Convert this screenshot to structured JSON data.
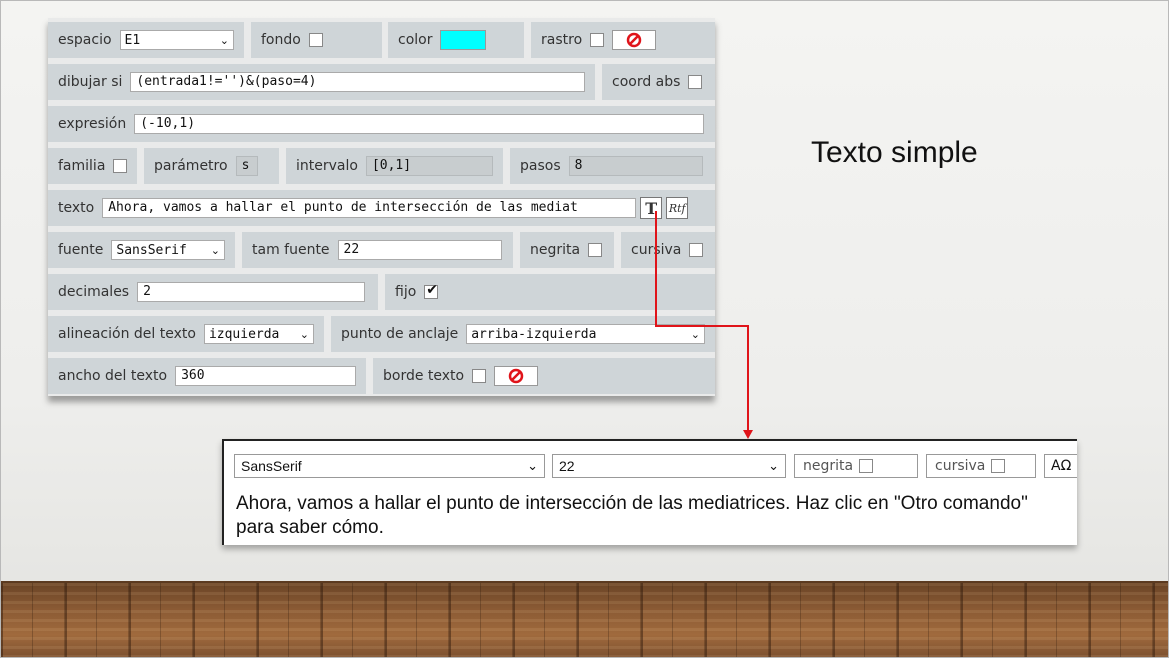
{
  "slide": {
    "title": "Texto simple"
  },
  "panel": {
    "espacio": {
      "label": "espacio",
      "value": "E1"
    },
    "fondo": {
      "label": "fondo",
      "checked": false
    },
    "color": {
      "label": "color",
      "value": "#00ffff"
    },
    "rastro": {
      "label": "rastro",
      "checked": false
    },
    "dibujar_si": {
      "label": "dibujar si",
      "value": "(entrada1!='')&(paso=4)"
    },
    "coord_abs": {
      "label": "coord abs",
      "checked": false
    },
    "expresion": {
      "label": "expresión",
      "value": "(-10,1)"
    },
    "familia": {
      "label": "familia",
      "checked": false
    },
    "parametro": {
      "label": "parámetro",
      "value": "s"
    },
    "intervalo": {
      "label": "intervalo",
      "value": "[0,1]"
    },
    "pasos": {
      "label": "pasos",
      "value": "8"
    },
    "texto": {
      "label": "texto",
      "value": "Ahora, vamos a hallar el punto de intersección de las mediat",
      "t_button": "T",
      "rtf_button": "Rtf"
    },
    "fuente": {
      "label": "fuente",
      "value": "SansSerif"
    },
    "tam_fuente": {
      "label": "tam fuente",
      "value": "22"
    },
    "negrita": {
      "label": "negrita",
      "checked": false
    },
    "cursiva": {
      "label": "cursiva",
      "checked": false
    },
    "decimales": {
      "label": "decimales",
      "value": "2"
    },
    "fijo": {
      "label": "fijo",
      "checked": true
    },
    "alineacion": {
      "label": "alineación del texto",
      "value": "izquierda"
    },
    "punto_anclaje": {
      "label": "punto de anclaje",
      "value": "arriba-izquierda"
    },
    "ancho_texto": {
      "label": "ancho del texto",
      "value": "360"
    },
    "borde_texto": {
      "label": "borde texto",
      "checked": false
    }
  },
  "editor": {
    "font": "SansSerif",
    "size": "22",
    "negrita": "negrita",
    "cursiva": "cursiva",
    "symbol_button": "AΩ",
    "text": "Ahora, vamos a hallar el punto de intersección de las mediatrices. Haz clic en \"Otro comando\" para saber cómo."
  },
  "colors": {
    "panel_cell": "#cfd5d8",
    "connector": "#e0141a",
    "no_icon": "#e0141a"
  }
}
